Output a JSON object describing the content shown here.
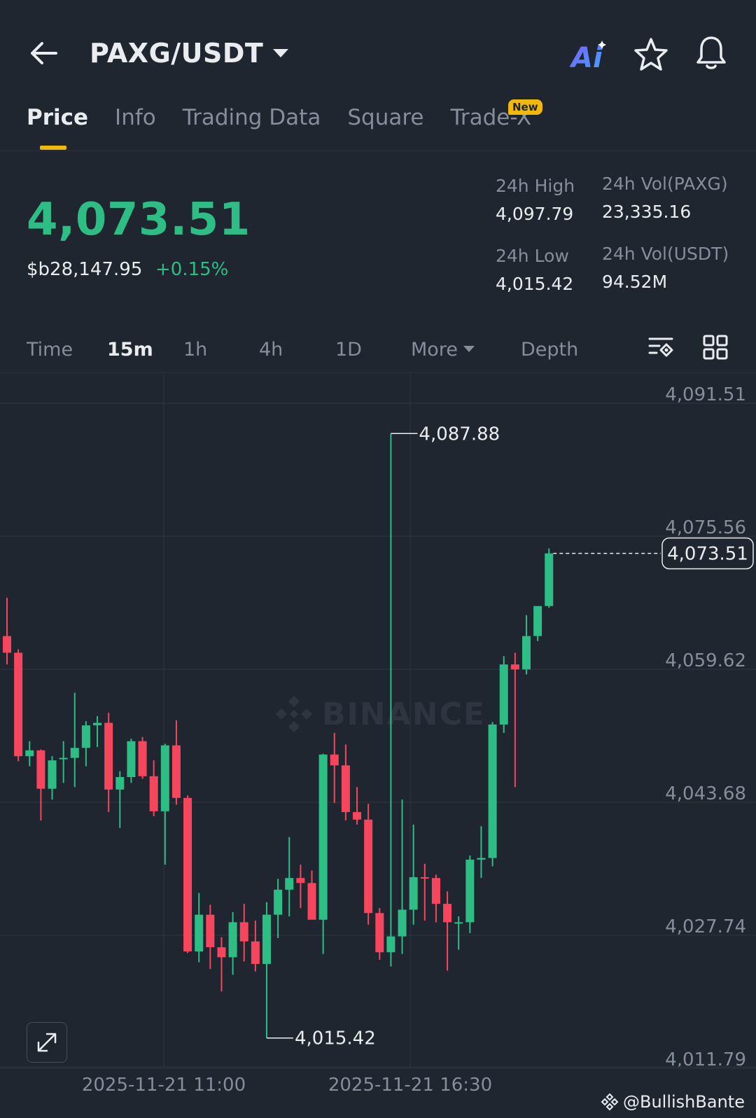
{
  "header": {
    "pair": "PAXG/USDT",
    "ai_label": "Ai"
  },
  "tabs": [
    {
      "label": "Price",
      "active": true
    },
    {
      "label": "Info"
    },
    {
      "label": "Trading Data"
    },
    {
      "label": "Square"
    },
    {
      "label": "Trade-X"
    }
  ],
  "new_badge": "New",
  "price": {
    "last": "4,073.51",
    "fiat": "$b28,147.95",
    "change": "+0.15%"
  },
  "stats": {
    "high_label": "24h High",
    "high_value": "4,097.79",
    "low_label": "24h Low",
    "low_value": "4,015.42",
    "vol_base_label": "24h Vol(PAXG)",
    "vol_base_value": "23,335.16",
    "vol_quote_label": "24h Vol(USDT)",
    "vol_quote_value": "94.52M"
  },
  "intervals": [
    "Time",
    "15m",
    "1h",
    "4h",
    "1D",
    "More",
    "Depth"
  ],
  "active_interval": "15m",
  "colors": {
    "up": "#2ebd85",
    "down": "#f6465d",
    "background": "#202630",
    "accent": "#f0b90b"
  },
  "icons": [
    "back-arrow-icon",
    "dropdown-caret-icon",
    "ai-icon",
    "star-icon",
    "bell-icon",
    "chart-settings-icon",
    "grid-layout-icon",
    "expand-icon",
    "binance-logo-icon"
  ],
  "watermark": "BINANCE",
  "footer_user": "@BullishBante",
  "chart_data": {
    "type": "candlestick",
    "interval": "15m",
    "y_ticks": [
      4091.51,
      4075.56,
      4059.62,
      4043.68,
      4027.74,
      4011.79
    ],
    "y_tick_labels": [
      "4,091.51",
      "4,075.56",
      "4,059.62",
      "4,043.68",
      "4,027.74",
      "4,011.79"
    ],
    "ylim": [
      4011.79,
      4091.51
    ],
    "x_tick_labels": [
      "2025-11-21 11:00",
      "2025-11-21 16:30"
    ],
    "last_price": 4073.51,
    "last_price_label": "4,073.51",
    "max_marker": {
      "value": 4087.88,
      "label": "4,087.88"
    },
    "min_marker": {
      "value": 4015.42,
      "label": "4,015.42"
    },
    "candles": [
      {
        "o": 4063.6,
        "h": 4068.2,
        "l": 4060.2,
        "c": 4061.6
      },
      {
        "o": 4061.6,
        "h": 4062.0,
        "l": 4048.6,
        "c": 4049.2
      },
      {
        "o": 4049.2,
        "h": 4051.0,
        "l": 4048.0,
        "c": 4049.9
      },
      {
        "o": 4049.9,
        "h": 4050.0,
        "l": 4041.5,
        "c": 4045.3
      },
      {
        "o": 4045.3,
        "h": 4049.2,
        "l": 4044.0,
        "c": 4048.7
      },
      {
        "o": 4048.9,
        "h": 4051.0,
        "l": 4046.0,
        "c": 4049.0
      },
      {
        "o": 4049.0,
        "h": 4056.8,
        "l": 4045.5,
        "c": 4050.2
      },
      {
        "o": 4050.2,
        "h": 4053.4,
        "l": 4048.0,
        "c": 4052.9
      },
      {
        "o": 4052.9,
        "h": 4054.0,
        "l": 4050.3,
        "c": 4053.2
      },
      {
        "o": 4053.2,
        "h": 4054.4,
        "l": 4042.5,
        "c": 4045.2
      },
      {
        "o": 4045.2,
        "h": 4047.4,
        "l": 4040.6,
        "c": 4046.7
      },
      {
        "o": 4046.7,
        "h": 4051.3,
        "l": 4046.0,
        "c": 4051.0
      },
      {
        "o": 4051.0,
        "h": 4051.5,
        "l": 4046.5,
        "c": 4046.8
      },
      {
        "o": 4046.8,
        "h": 4048.7,
        "l": 4042.0,
        "c": 4042.6
      },
      {
        "o": 4042.6,
        "h": 4050.7,
        "l": 4036.2,
        "c": 4050.5
      },
      {
        "o": 4050.5,
        "h": 4053.5,
        "l": 4043.4,
        "c": 4044.2
      },
      {
        "o": 4044.2,
        "h": 4044.5,
        "l": 4025.6,
        "c": 4025.8
      },
      {
        "o": 4025.8,
        "h": 4032.8,
        "l": 4024.5,
        "c": 4030.2
      },
      {
        "o": 4030.2,
        "h": 4031.4,
        "l": 4023.7,
        "c": 4026.3
      },
      {
        "o": 4026.3,
        "h": 4027.5,
        "l": 4021.0,
        "c": 4025.1
      },
      {
        "o": 4025.1,
        "h": 4030.5,
        "l": 4023.0,
        "c": 4029.3
      },
      {
        "o": 4029.3,
        "h": 4031.5,
        "l": 4024.6,
        "c": 4027.0
      },
      {
        "o": 4027.0,
        "h": 4029.5,
        "l": 4023.4,
        "c": 4024.3
      },
      {
        "o": 4024.3,
        "h": 4031.7,
        "l": 4015.42,
        "c": 4030.2
      },
      {
        "o": 4030.2,
        "h": 4034.5,
        "l": 4027.4,
        "c": 4033.2
      },
      {
        "o": 4033.2,
        "h": 4039.5,
        "l": 4030.0,
        "c": 4034.6
      },
      {
        "o": 4034.6,
        "h": 4036.2,
        "l": 4031.0,
        "c": 4034.0
      },
      {
        "o": 4034.0,
        "h": 4035.5,
        "l": 4030.0,
        "c": 4029.6
      },
      {
        "o": 4029.6,
        "h": 4049.5,
        "l": 4025.5,
        "c": 4049.4
      },
      {
        "o": 4049.4,
        "h": 4052.0,
        "l": 4043.6,
        "c": 4048.1
      },
      {
        "o": 4048.1,
        "h": 4050.6,
        "l": 4041.5,
        "c": 4042.5
      },
      {
        "o": 4042.5,
        "h": 4045.5,
        "l": 4041.0,
        "c": 4041.6
      },
      {
        "o": 4041.6,
        "h": 4043.5,
        "l": 4029.0,
        "c": 4030.4
      },
      {
        "o": 4030.4,
        "h": 4031.0,
        "l": 4024.8,
        "c": 4025.7
      },
      {
        "o": 4025.7,
        "h": 4087.88,
        "l": 4024.0,
        "c": 4027.6
      },
      {
        "o": 4027.6,
        "h": 4044.0,
        "l": 4025.5,
        "c": 4030.8
      },
      {
        "o": 4030.8,
        "h": 4041.0,
        "l": 4029.0,
        "c": 4034.7
      },
      {
        "o": 4034.7,
        "h": 4036.3,
        "l": 4029.5,
        "c": 4034.6
      },
      {
        "o": 4034.6,
        "h": 4035.0,
        "l": 4029.3,
        "c": 4031.5
      },
      {
        "o": 4031.5,
        "h": 4033.0,
        "l": 4023.5,
        "c": 4029.3
      },
      {
        "o": 4029.3,
        "h": 4030.0,
        "l": 4026.0,
        "c": 4029.3
      },
      {
        "o": 4029.3,
        "h": 4037.3,
        "l": 4028.0,
        "c": 4036.8
      },
      {
        "o": 4036.8,
        "h": 4040.8,
        "l": 4034.6,
        "c": 4037.0
      },
      {
        "o": 4037.0,
        "h": 4053.3,
        "l": 4036.0,
        "c": 4053.0
      },
      {
        "o": 4053.0,
        "h": 4061.2,
        "l": 4052.0,
        "c": 4060.2
      },
      {
        "o": 4060.2,
        "h": 4061.6,
        "l": 4045.5,
        "c": 4059.6
      },
      {
        "o": 4059.6,
        "h": 4066.1,
        "l": 4059.0,
        "c": 4063.6
      },
      {
        "o": 4063.6,
        "h": 4066.8,
        "l": 4063.0,
        "c": 4067.2
      },
      {
        "o": 4067.2,
        "h": 4074.1,
        "l": 4067.0,
        "c": 4073.51
      }
    ]
  }
}
